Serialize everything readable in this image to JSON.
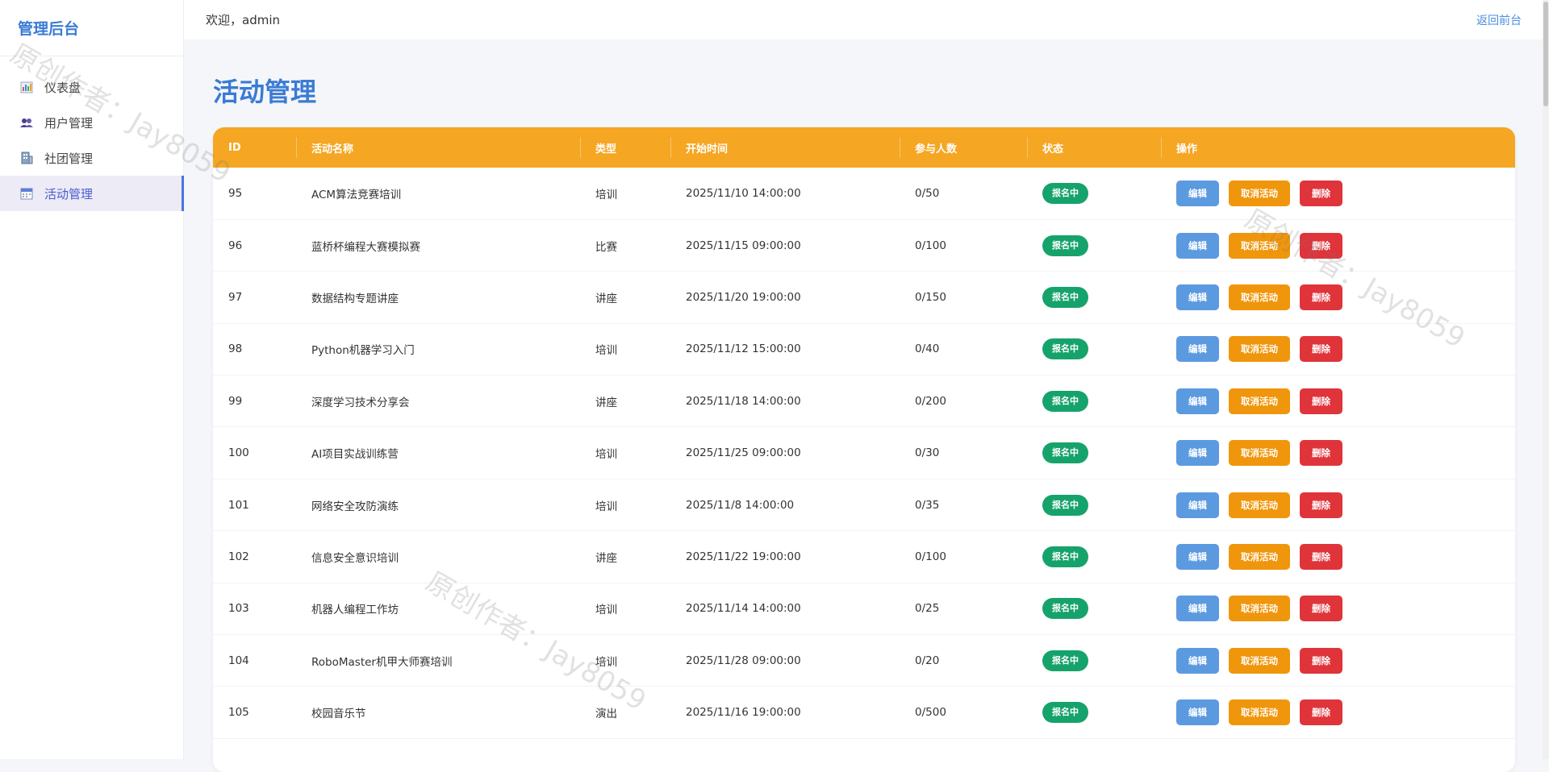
{
  "sidebar": {
    "brand": "管理后台",
    "items": [
      {
        "label": "仪表盘",
        "icon": "dashboard-icon"
      },
      {
        "label": "用户管理",
        "icon": "users-icon"
      },
      {
        "label": "社团管理",
        "icon": "building-icon"
      },
      {
        "label": "活动管理",
        "icon": "calendar-icon",
        "active": true
      }
    ]
  },
  "topbar": {
    "welcome": "欢迎，admin",
    "back_link": "返回前台"
  },
  "page": {
    "title": "活动管理"
  },
  "table": {
    "headers": [
      "ID",
      "活动名称",
      "类型",
      "开始时间",
      "参与人数",
      "状态",
      "操作"
    ],
    "actions": {
      "edit": "编辑",
      "cancel": "取消活动",
      "delete": "删除"
    },
    "rows": [
      {
        "id": "95",
        "name": "ACM算法竞赛培训",
        "type": "培训",
        "start": "2025/11/10 14:00:00",
        "participants": "0/50",
        "status": "报名中"
      },
      {
        "id": "96",
        "name": "蓝桥杯编程大赛模拟赛",
        "type": "比赛",
        "start": "2025/11/15 09:00:00",
        "participants": "0/100",
        "status": "报名中"
      },
      {
        "id": "97",
        "name": "数据结构专题讲座",
        "type": "讲座",
        "start": "2025/11/20 19:00:00",
        "participants": "0/150",
        "status": "报名中"
      },
      {
        "id": "98",
        "name": "Python机器学习入门",
        "type": "培训",
        "start": "2025/11/12 15:00:00",
        "participants": "0/40",
        "status": "报名中"
      },
      {
        "id": "99",
        "name": "深度学习技术分享会",
        "type": "讲座",
        "start": "2025/11/18 14:00:00",
        "participants": "0/200",
        "status": "报名中"
      },
      {
        "id": "100",
        "name": "AI项目实战训练营",
        "type": "培训",
        "start": "2025/11/25 09:00:00",
        "participants": "0/30",
        "status": "报名中"
      },
      {
        "id": "101",
        "name": "网络安全攻防演练",
        "type": "培训",
        "start": "2025/11/8 14:00:00",
        "participants": "0/35",
        "status": "报名中"
      },
      {
        "id": "102",
        "name": "信息安全意识培训",
        "type": "讲座",
        "start": "2025/11/22 19:00:00",
        "participants": "0/100",
        "status": "报名中"
      },
      {
        "id": "103",
        "name": "机器人编程工作坊",
        "type": "培训",
        "start": "2025/11/14 14:00:00",
        "participants": "0/25",
        "status": "报名中"
      },
      {
        "id": "104",
        "name": "RoboMaster机甲大师赛培训",
        "type": "培训",
        "start": "2025/11/28 09:00:00",
        "participants": "0/20",
        "status": "报名中"
      },
      {
        "id": "105",
        "name": "校园音乐节",
        "type": "演出",
        "start": "2025/11/16 19:00:00",
        "participants": "0/500",
        "status": "报名中"
      }
    ]
  },
  "watermark": "原创作者：Jay8059",
  "colors": {
    "accent": "#3a7bd5",
    "header": "#f5a623",
    "status": "#16a36b",
    "edit": "#5c9ae0",
    "cancel": "#f0960c",
    "delete": "#e0343b"
  }
}
